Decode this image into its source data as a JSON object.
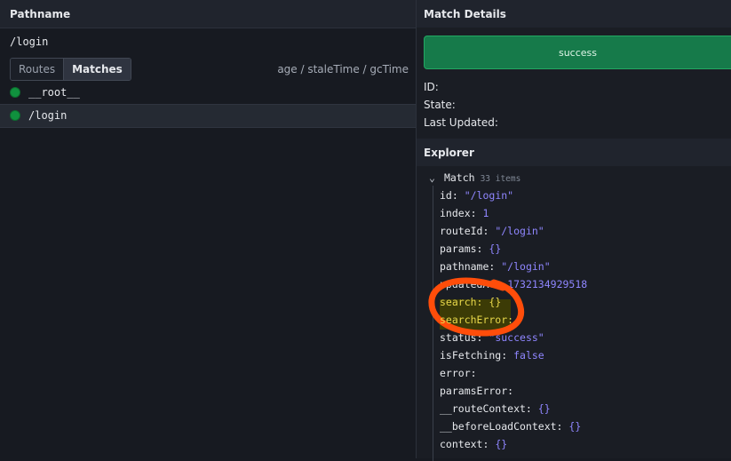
{
  "left": {
    "header_title": "Pathname",
    "pathname": "/login",
    "tabs": [
      {
        "label": "Routes",
        "active": false
      },
      {
        "label": "Matches",
        "active": true
      }
    ],
    "column_hint": "age / staleTime / gcTime",
    "matches": [
      {
        "label": "__root__",
        "status_color": "#10913e",
        "selected": false
      },
      {
        "label": "/login",
        "status_color": "#10913e",
        "selected": true
      }
    ]
  },
  "right": {
    "header_title": "Match Details",
    "status": "success",
    "id_label": "ID:",
    "state_label": "State:",
    "last_updated_label": "Last Updated:",
    "explorer_title": "Explorer",
    "tree_root": "Match",
    "tree_count": "33 items",
    "properties": [
      {
        "key": "id:",
        "value": "\"/login\""
      },
      {
        "key": "index:",
        "value": "1"
      },
      {
        "key": "routeId:",
        "value": "\"/login\""
      },
      {
        "key": "params:",
        "value": "{}"
      },
      {
        "key": "pathname:",
        "value": "\"/login\""
      },
      {
        "key": "updatedAt:",
        "value": "1732134929518"
      },
      {
        "key": "search:",
        "value": "{}"
      },
      {
        "key": "searchError:",
        "value": ""
      },
      {
        "key": "status:",
        "value": "\"success\""
      },
      {
        "key": "isFetching:",
        "value": "false"
      },
      {
        "key": "error:",
        "value": ""
      },
      {
        "key": "paramsError:",
        "value": ""
      },
      {
        "key": "__routeContext:",
        "value": "{}"
      },
      {
        "key": "__beforeLoadContext:",
        "value": "{}"
      },
      {
        "key": "context:",
        "value": "{}"
      }
    ]
  },
  "colors": {
    "success_bg": "#167a4a",
    "value_purple": "#8f86ff",
    "annotation_orange": "#ff4d0a"
  }
}
